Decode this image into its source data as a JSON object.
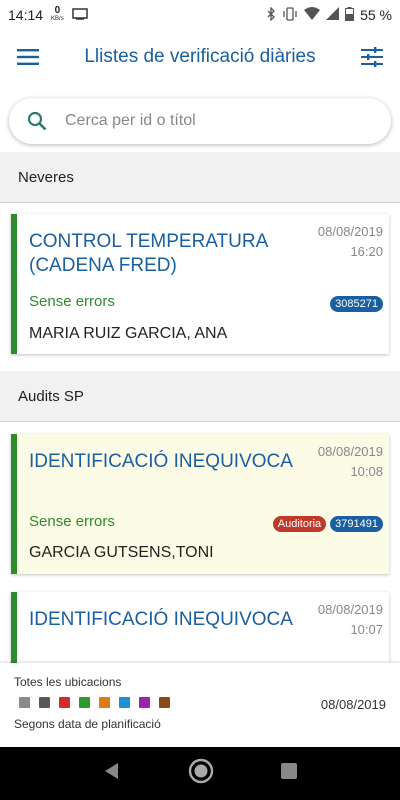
{
  "status_bar": {
    "time": "14:14",
    "net_speed": "0",
    "net_unit": "KB/s",
    "battery": "55 %"
  },
  "app_bar": {
    "title": "Llistes de verificació diàries",
    "menu_icon": "hamburger-menu-icon",
    "filter_icon": "tune-sliders-icon"
  },
  "search": {
    "placeholder": "Cerca per id o títol"
  },
  "sections": [
    {
      "header": "Neveres",
      "cards": [
        {
          "title": "CONTROL TEMPERATURA (CADENA FRED)",
          "date": "08/08/2019",
          "time": "16:20",
          "status": "Sense errors",
          "badges": [
            {
              "type": "id",
              "label": "3085271"
            }
          ],
          "person": "MARIA RUIZ GARCIA, ANA"
        }
      ]
    },
    {
      "header": "Audits SP",
      "cards": [
        {
          "title": "IDENTIFICACIÓ INEQUIVOCA",
          "date": "08/08/2019",
          "time": "10:08",
          "status": "Sense errors",
          "badges": [
            {
              "type": "audit",
              "label": "Auditoria"
            },
            {
              "type": "id",
              "label": "3791491"
            }
          ],
          "person": "GARCIA GUTSENS,TONI"
        },
        {
          "title": "IDENTIFICACIÓ INEQUIVOCA",
          "date": "08/08/2019",
          "time": "10:07"
        }
      ]
    }
  ],
  "footer": {
    "location_label": "Totes les ubicacions",
    "date": "08/08/2019",
    "sort_label": "Segons data de planificació",
    "colors": [
      "#8a8a8a",
      "#5a5a5a",
      "#d62b2b",
      "#2e9a2e",
      "#e07b14",
      "#1e8fd0",
      "#a020b0",
      "#8b4a1c"
    ]
  },
  "colors": {
    "accent": "#1a5fa0",
    "success": "#2e8b2e",
    "audit_badge": "#c0392b"
  }
}
